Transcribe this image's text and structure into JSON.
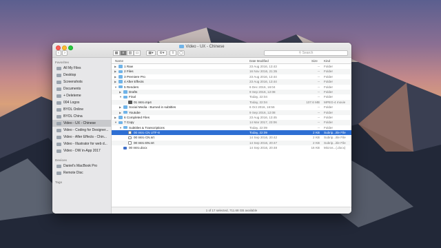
{
  "window": {
    "title": "Video - UX - Chinese"
  },
  "toolbar": {
    "back": "‹",
    "forward": "›",
    "search_placeholder": "Search"
  },
  "sidebar": {
    "favorites_heading": "Favorites",
    "favorites": [
      {
        "label": "All My Files"
      },
      {
        "label": "Desktop"
      },
      {
        "label": "Screenshots"
      },
      {
        "label": "Documents"
      },
      {
        "label": "+ Deleteme"
      },
      {
        "label": "004 Logos"
      },
      {
        "label": "BYOL Online"
      },
      {
        "label": "BYOL China"
      },
      {
        "label": "Video - UX - Chinese"
      },
      {
        "label": "Video - Coding for Designer..."
      },
      {
        "label": "Video - After Effects - Chin..."
      },
      {
        "label": "Video - Illustrator for web d..."
      },
      {
        "label": "Video - DW in-App 2017"
      }
    ],
    "devices_heading": "Devices",
    "devices": [
      {
        "label": "Daniel's MacBook Pro"
      },
      {
        "label": "Remote Disc"
      }
    ],
    "tags_heading": "Tags"
  },
  "columns": {
    "name": "Name",
    "date": "Date Modified",
    "size": "Size",
    "kind": "Kind"
  },
  "rows": [
    {
      "name": "1 Raw",
      "date": "23 Aug 2016, 13:43",
      "size": "--",
      "kind": "Folder",
      "level": 0,
      "tri": "▶",
      "icon": "folder"
    },
    {
      "name": "2 Files",
      "date": "16 Nov 2016, 21:35",
      "size": "--",
      "kind": "Folder",
      "level": 0,
      "tri": "▶",
      "icon": "folder"
    },
    {
      "name": "3 Premiere Pro",
      "date": "23 Aug 2016, 13:44",
      "size": "--",
      "kind": "Folder",
      "level": 0,
      "tri": "▶",
      "icon": "folder"
    },
    {
      "name": "4 After Effects",
      "date": "23 Aug 2016, 13:44",
      "size": "--",
      "kind": "Folder",
      "level": 0,
      "tri": "▶",
      "icon": "folder"
    },
    {
      "name": "5 Renders",
      "date": "6 Dec 2016, 16:04",
      "size": "--",
      "kind": "Folder",
      "level": 0,
      "tri": "▼",
      "icon": "folder"
    },
    {
      "name": "Drafts",
      "date": "9 Sep 2016, 12:08",
      "size": "--",
      "kind": "Folder",
      "level": 1,
      "tri": "▶",
      "icon": "folder"
    },
    {
      "name": "Final",
      "date": "Today, 22:04",
      "size": "--",
      "kind": "Folder",
      "level": 1,
      "tri": "▼",
      "icon": "folder"
    },
    {
      "name": "01 Intro.mp4",
      "date": "Today, 22:04",
      "size": "107.6 MB",
      "kind": "MPEG-4 movie",
      "level": 2,
      "tri": "",
      "icon": "movie"
    },
    {
      "name": "Social Media - Burned in subtitles",
      "date": "6 Oct 2016, 16:56",
      "size": "--",
      "kind": "Folder",
      "level": 1,
      "tri": "▶",
      "icon": "folder"
    },
    {
      "name": "Youtube",
      "date": "9 Sep 2016, 12:08",
      "size": "--",
      "kind": "Folder",
      "level": 1,
      "tri": "▶",
      "icon": "folder"
    },
    {
      "name": "6 Completed Files",
      "date": "23 Aug 2016, 13:45",
      "size": "--",
      "kind": "Folder",
      "level": 0,
      "tri": "▶",
      "icon": "folder"
    },
    {
      "name": "7 Copy",
      "date": "14 Mar 2017, 23:06",
      "size": "--",
      "kind": "Folder",
      "level": 0,
      "tri": "▼",
      "icon": "folder"
    },
    {
      "name": "Subtitles & Transcriptions",
      "date": "Today, 22:09",
      "size": "--",
      "kind": "Folder",
      "level": 1,
      "tri": "▼",
      "icon": "folder"
    },
    {
      "name": "00 Intro CN UTF-8",
      "date": "Today, 22:09",
      "size": "2 KB",
      "kind": "Subrip...itle File",
      "level": 2,
      "tri": "",
      "icon": "file",
      "selected": true
    },
    {
      "name": "00 Intro CN.srt",
      "date": "14 Sep 2016, 20:42",
      "size": "2 KB",
      "kind": "Subrip...itle File",
      "level": 2,
      "tri": "",
      "icon": "file"
    },
    {
      "name": "00 Intro EN.srt",
      "date": "14 Sep 2016, 20:47",
      "size": "2 KB",
      "kind": "Subrip...itle File",
      "level": 2,
      "tri": "",
      "icon": "file"
    },
    {
      "name": "00 Intro.docx",
      "date": "14 Sep 2016, 20:48",
      "size": "16 KB",
      "kind": "Micros...(.docx)",
      "level": 1,
      "tri": "",
      "icon": "doc"
    }
  ],
  "status": "1 of 17 selected, 711.68 GB available"
}
